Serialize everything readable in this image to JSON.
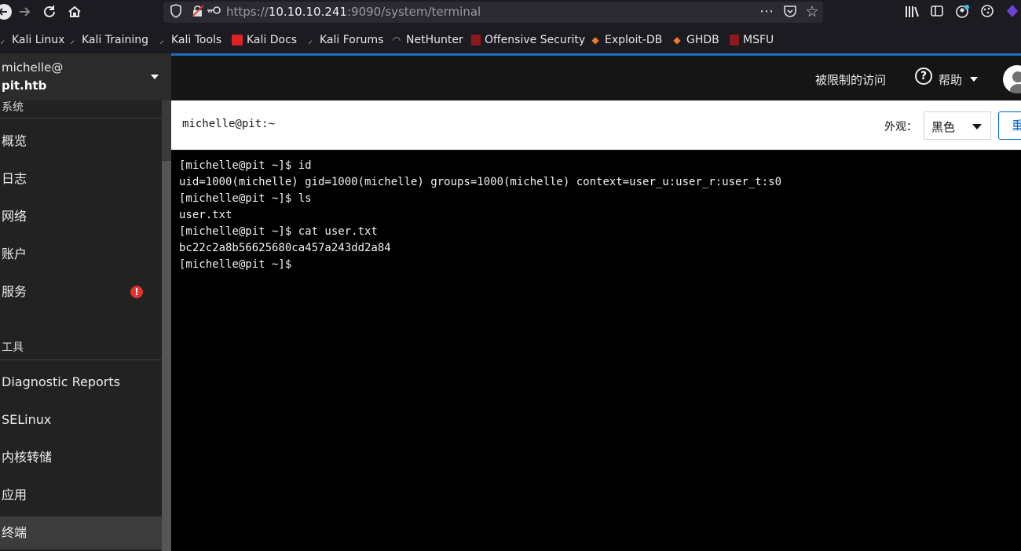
{
  "browser": {
    "url_prefix": "https://",
    "url_host": "10.10.10.241",
    "url_path": ":9090/system/terminal",
    "page_actions_icon": "⋯"
  },
  "bookmarks": [
    {
      "label": "Kali Linux",
      "icon": "kali-dragon-icon"
    },
    {
      "label": "Kali Training",
      "icon": "kali-dragon-icon"
    },
    {
      "label": "Kali Tools",
      "icon": "kali-dragon-icon"
    },
    {
      "label": "Kali Docs",
      "icon": "kali-docs-icon"
    },
    {
      "label": "Kali Forums",
      "icon": "kali-dragon-icon"
    },
    {
      "label": "NetHunter",
      "icon": "nethunter-icon"
    },
    {
      "label": "Offensive Security",
      "icon": "offsec-icon"
    },
    {
      "label": "Exploit-DB",
      "icon": "exploitdb-icon"
    },
    {
      "label": "GHDB",
      "icon": "exploitdb-icon"
    },
    {
      "label": "MSFU",
      "icon": "offsec-icon"
    }
  ],
  "host": {
    "user": "michelle@",
    "hostname": "pit.htb"
  },
  "header": {
    "limited_access": "被限制的访问",
    "help": "帮助"
  },
  "sidebar": {
    "system_title": "系统",
    "system_items": [
      "概览",
      "日志",
      "网络",
      "账户",
      "服务"
    ],
    "tools_title": "工具",
    "tools_items": [
      "Diagnostic Reports",
      "SELinux",
      "内核转储",
      "应用",
      "终端"
    ],
    "active_item": "终端"
  },
  "terminal": {
    "title": "michelle@pit:~",
    "appearance_label": "外观：",
    "appearance_value": "黑色",
    "reset_label": "重",
    "lines": [
      "[michelle@pit ~]$ id",
      "uid=1000(michelle) gid=1000(michelle) groups=1000(michelle) context=user_u:user_r:user_t:s0",
      "[michelle@pit ~]$ ls",
      "user.txt",
      "[michelle@pit ~]$ cat user.txt",
      "bc22c2a8b56625680ca457a243dd2a84",
      "[michelle@pit ~]$ "
    ]
  },
  "colors": {
    "accent": "#1f6fc0",
    "alert": "#e0322f",
    "terminal_bg": "#000000"
  }
}
